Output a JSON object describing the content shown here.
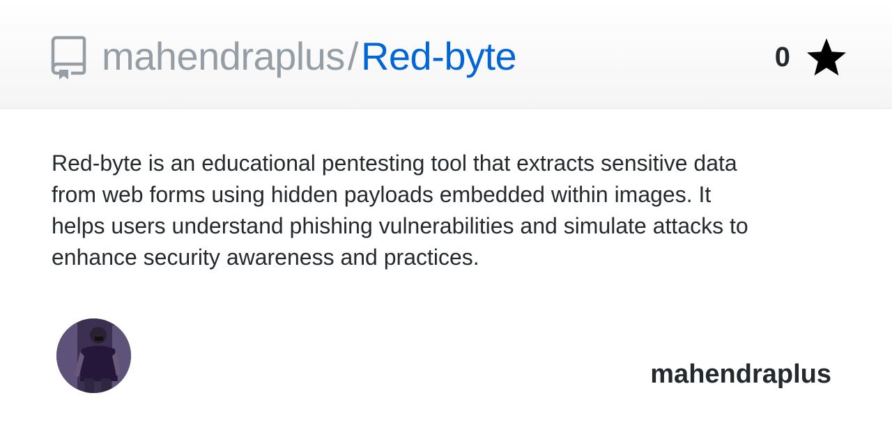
{
  "repo": {
    "owner": "mahendraplus",
    "separator": "/",
    "name": "Red-byte",
    "star_count": "0",
    "description": "Red-byte is an educational pentesting tool that extracts sensitive data from web forms using hidden payloads embedded within images. It helps users understand phishing vulnerabilities and simulate attacks to enhance security awareness and practices."
  },
  "footer": {
    "owner_label": "mahendraplus"
  },
  "icons": {
    "repo": "repo-icon",
    "star": "star-icon",
    "avatar": "avatar"
  },
  "colors": {
    "owner": "#959da5",
    "repo_name": "#0366d6",
    "text": "#24292e",
    "header_border": "#e1e4e8"
  }
}
